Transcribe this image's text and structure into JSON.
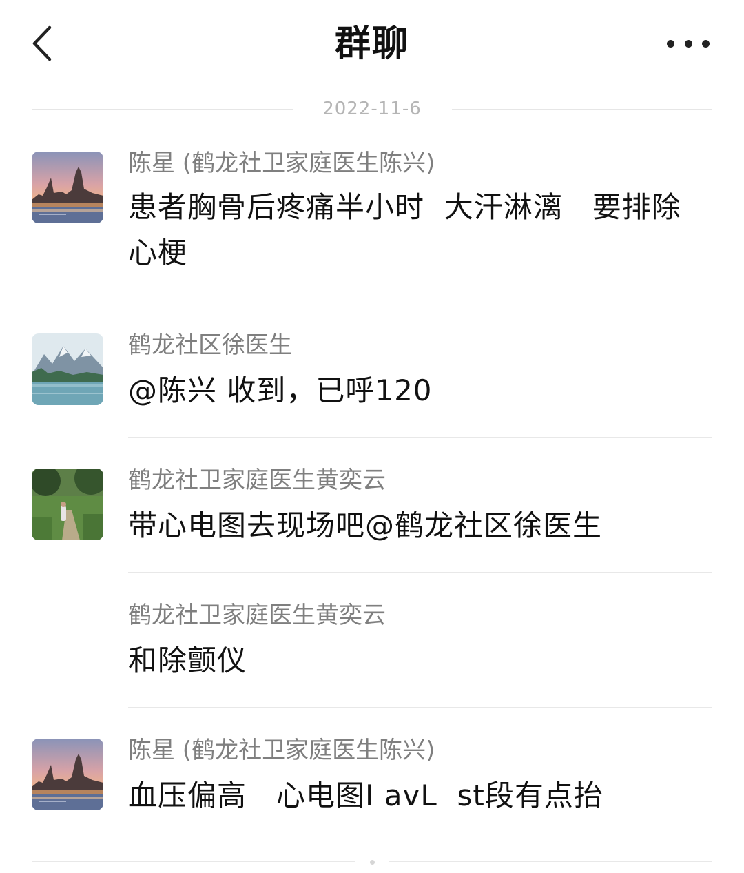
{
  "header": {
    "title": "群聊"
  },
  "date_divider": "2022-11-6",
  "messages": [
    {
      "sender": "陈星 (鹤龙社卫家庭医生陈兴)",
      "text": "患者胸骨后疼痛半小时  大汗淋漓   要排除心梗",
      "avatar": "city-river-dusk"
    },
    {
      "sender": "鹤龙社区徐医生",
      "text": "@陈兴 收到，已呼120",
      "avatar": "mountain-lake"
    },
    {
      "sender": "鹤龙社卫家庭医生黄奕云",
      "text": "带心电图去现场吧@鹤龙社区徐医生",
      "avatar": "forest-path-child"
    },
    {
      "sender": "鹤龙社卫家庭医生黄奕云",
      "text": "和除颤仪"
    },
    {
      "sender": "陈星 (鹤龙社卫家庭医生陈兴)",
      "text": "血压偏高   心电图Ⅰ avL  st段有点抬",
      "avatar": "city-river-dusk"
    }
  ]
}
